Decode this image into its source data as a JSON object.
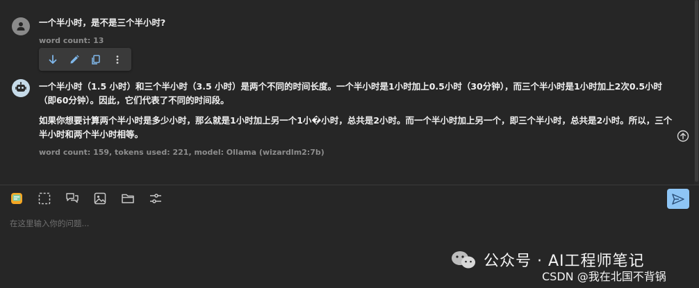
{
  "user_message": {
    "avatar_icon": "person-icon",
    "text": "一个半小时，是不是三个半小时?",
    "meta": "word count: 13",
    "actions": [
      "arrow-down-icon",
      "pencil-icon",
      "copy-icon",
      "more-vertical-icon"
    ]
  },
  "bot_message": {
    "avatar_icon": "robot-icon",
    "para1": "一个半小时（1.5 小时）和三个半小时（3.5 小时）是两个不同的时间长度。一个半小时是1小时加上0.5小时（30分钟），而三个半小时是1小时加上2次0.5小时（即60分钟）。因此，它们代表了不同的时间段。",
    "para2": "如果你想要计算两个半小时是多少小时，那么就是1小时加上另一个1小�小时，总共是2小时。而一个半小时加上另一个，即三个半小时，总共是2小时。所以，三个半小时和两个半小时相等。",
    "meta": "word count: 159, tokens used: 221, model: Ollama (wizardlm2:7b)"
  },
  "toolbar": {
    "tools": [
      "chat-bubble-icon",
      "select-region-icon",
      "conversation-icon",
      "image-icon",
      "folder-icon",
      "settings-sliders-icon"
    ],
    "send_icon": "send-icon"
  },
  "input": {
    "placeholder": "在这里输入你的问题..."
  },
  "watermark": {
    "text": "公众号 · AI工程师笔记",
    "csdn": "CSDN @我在北国不背锅"
  },
  "colors": {
    "background": "#262626",
    "send_button": "#8ec5f5",
    "bot_avatar": "#c6dbe9"
  }
}
